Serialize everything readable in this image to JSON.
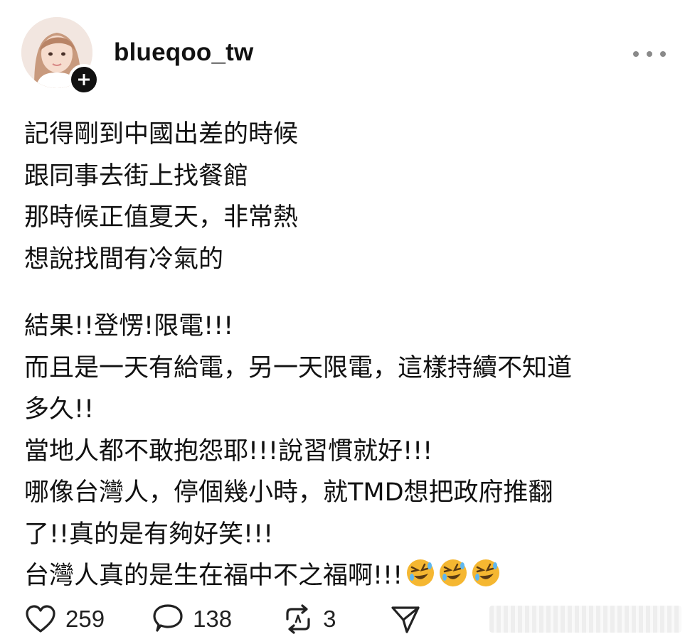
{
  "post": {
    "username": "blueqoo_tw",
    "body_lines": [
      "記得剛到中國出差的時候",
      "跟同事去街上找餐館",
      "那時候正值夏天，非常熱",
      "想說找間有冷氣的",
      "結果!!登愣!限電!!!",
      "而且是一天有給電，另一天限電，這樣持續不知道",
      "多久!!",
      "當地人都不敢抱怨耶!!!說習慣就好!!!",
      "哪像台灣人，停個幾小時，就TMD想把政府推翻",
      "了!!真的是有夠好笑!!!",
      "台灣人真的是生在福中不之福啊!!!"
    ],
    "trailing_emoji": [
      "rolling-on-floor-laughing-emoji",
      "rolling-on-floor-laughing-emoji",
      "rolling-on-floor-laughing-emoji"
    ]
  },
  "actions": {
    "likes": "259",
    "comments": "138",
    "reposts": "3"
  },
  "icons": {
    "more": "more-horizontal-icon",
    "like": "heart-icon",
    "comment": "comment-bubble-icon",
    "repost": "repost-icon",
    "share": "send-icon",
    "follow": "plus-icon"
  },
  "colors": {
    "text": "#111111",
    "muted": "#8a8a8a",
    "emoji": "#f5b731"
  }
}
